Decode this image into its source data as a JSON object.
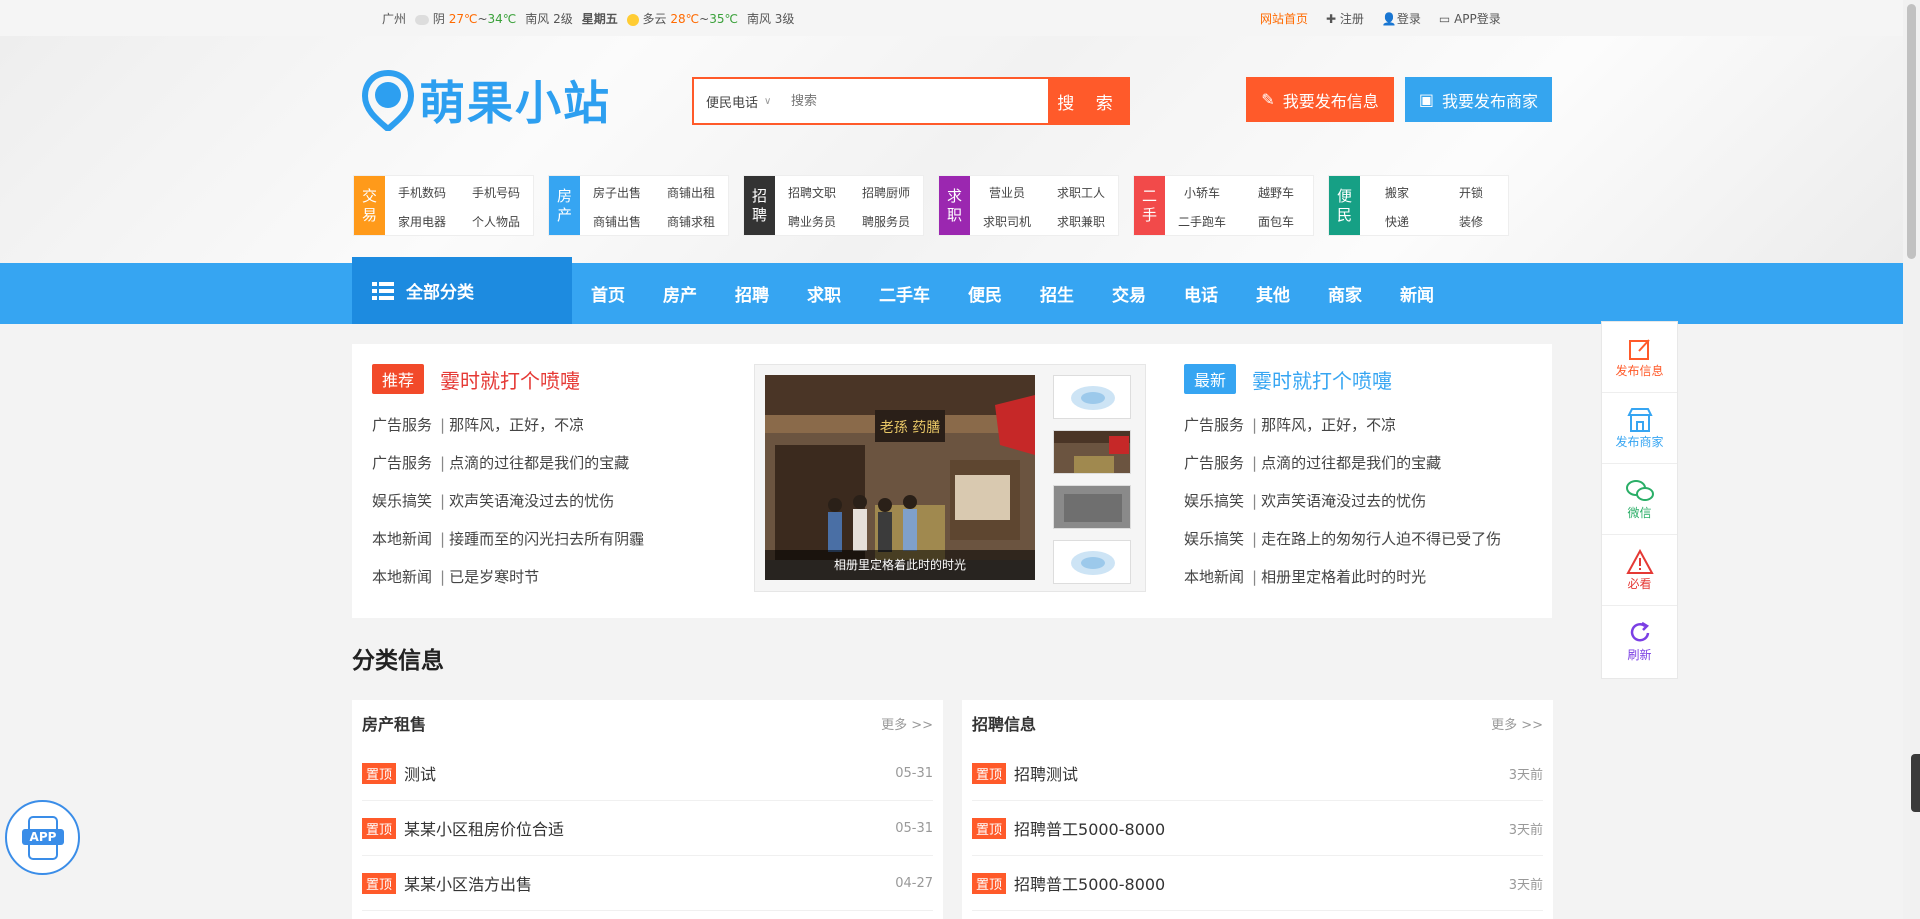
{
  "topbar": {
    "city": "广州",
    "day1": {
      "cond": "阴",
      "high": "27℃",
      "sep": "~",
      "low": "34℃",
      "wind": "南风 2级",
      "weekday": "星期五"
    },
    "day2": {
      "cond": "多云",
      "high": "28℃",
      "sep": "~",
      "low": "35℃",
      "wind": "南风 3级"
    },
    "links": {
      "home": "网站首页",
      "register": "注册",
      "login": "登录",
      "app_login": "APP登录"
    }
  },
  "header": {
    "logo_text": "萌果小站",
    "search": {
      "category": "便民电话",
      "placeholder": "搜索",
      "button": "搜 索"
    },
    "publish_info": "我要发布信息",
    "publish_shop": "我要发布商家"
  },
  "categories": [
    {
      "tag": "交易",
      "color": "#ff9a1a",
      "links": [
        "手机数码",
        "手机号码",
        "家用电器",
        "个人物品"
      ]
    },
    {
      "tag": "房产",
      "color": "#36a5f2",
      "links": [
        "房子出售",
        "商铺出租",
        "商铺出售",
        "商铺求租"
      ]
    },
    {
      "tag": "招聘",
      "color": "#333333",
      "links": [
        "招聘文职",
        "招聘厨师",
        "聘业务员",
        "聘服务员"
      ]
    },
    {
      "tag": "求职",
      "color": "#9b27b0",
      "links": [
        "营业员",
        "求职工人",
        "求职司机",
        "求职兼职"
      ]
    },
    {
      "tag": "二手",
      "color": "#f24a4a",
      "links": [
        "小轿车",
        "越野车",
        "二手跑车",
        "面包车"
      ]
    },
    {
      "tag": "便民",
      "color": "#16a085",
      "links": [
        "搬家",
        "开锁",
        "快递",
        "装修"
      ]
    }
  ],
  "nav": {
    "all_label": "全部分类",
    "items": [
      "首页",
      "房产",
      "招聘",
      "求职",
      "二手车",
      "便民",
      "招生",
      "交易",
      "电话",
      "其他",
      "商家",
      "新闻"
    ]
  },
  "recommend": {
    "badge": "推荐",
    "title": "霎时就打个喷嚏",
    "rows": [
      {
        "cat": "广告服务",
        "text": "那阵风，正好，不凉"
      },
      {
        "cat": "广告服务",
        "text": "点滴的过往都是我们的宝藏"
      },
      {
        "cat": "娱乐搞笑",
        "text": "欢声笑语淹没过去的忧伤"
      },
      {
        "cat": "本地新闻",
        "text": "接踵而至的闪光扫去所有阴霾"
      },
      {
        "cat": "本地新闻",
        "text": "已是岁寒时节"
      }
    ]
  },
  "slider": {
    "caption": "相册里定格着此时的时光",
    "sign": "老孫 药膳"
  },
  "latest": {
    "badge": "最新",
    "title": "霎时就打个喷嚏",
    "rows": [
      {
        "cat": "广告服务",
        "text": "那阵风，正好，不凉"
      },
      {
        "cat": "广告服务",
        "text": "点滴的过往都是我们的宝藏"
      },
      {
        "cat": "娱乐搞笑",
        "text": "欢声笑语淹没过去的忧伤"
      },
      {
        "cat": "娱乐搞笑",
        "text": "走在路上的匆匆行人迫不得已受了伤"
      },
      {
        "cat": "本地新闻",
        "text": "相册里定格着此时的时光"
      }
    ]
  },
  "section_title": "分类信息",
  "panels": [
    {
      "title": "房产租售",
      "more": "更多 >>",
      "items": [
        {
          "tag": "置顶",
          "title": "测试",
          "date": "05-31"
        },
        {
          "tag": "置顶",
          "title": "某某小区租房价位合适",
          "date": "05-31"
        },
        {
          "tag": "置顶",
          "title": "某某小区浩方出售",
          "date": "04-27"
        }
      ]
    },
    {
      "title": "招聘信息",
      "more": "更多 >>",
      "items": [
        {
          "tag": "置顶",
          "title": "招聘测试",
          "date": "3天前"
        },
        {
          "tag": "置顶",
          "title": "招聘普工5000-8000",
          "date": "3天前"
        },
        {
          "tag": "置顶",
          "title": "招聘普工5000-8000",
          "date": "3天前"
        }
      ]
    }
  ],
  "float_bar": [
    {
      "label": "发布信息",
      "color": "#ff5a2a",
      "icon": "edit-icon"
    },
    {
      "label": "发布商家",
      "color": "#36a5f2",
      "icon": "shop-icon"
    },
    {
      "label": "微信",
      "color": "#2aae67",
      "icon": "wechat-icon"
    },
    {
      "label": "必看",
      "color": "#e53935",
      "icon": "warning-icon"
    },
    {
      "label": "刷新",
      "color": "#7b3fe4",
      "icon": "refresh-icon"
    }
  ],
  "app_badge": "APP"
}
